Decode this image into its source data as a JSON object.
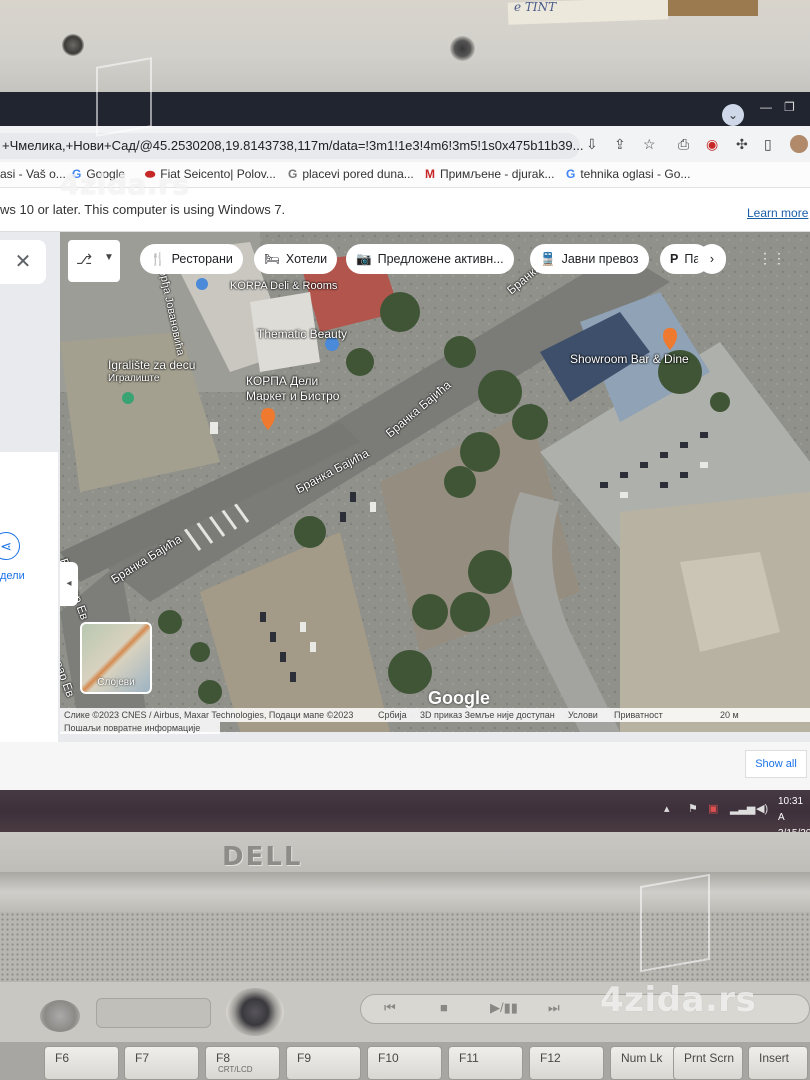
{
  "browser": {
    "url": "+Чмелика,+Нови+Сад/@45.2530208,19.8143738,117m/data=!3m1!1e3!4m6!3m5!1s0x475b11b39...",
    "bookmarks": [
      {
        "icon": "",
        "label": "asi - Vaš o..."
      },
      {
        "icon": "",
        "label": "Fiat Seicento| Polov..."
      },
      {
        "icon": "G",
        "label": "placevi pored duna..."
      },
      {
        "icon": "M",
        "label": "Примљене - djurak..."
      },
      {
        "icon": "G",
        "label": "tehnika oglasi - Go..."
      }
    ],
    "bookmark_google": {
      "icon": "G",
      "label": "Google"
    },
    "infobar": {
      "message": "ws 10 or later. This computer is using Windows 7.",
      "learn_more": "Learn more"
    }
  },
  "maps": {
    "chips": [
      {
        "icon": "🍴",
        "label": "Ресторани"
      },
      {
        "icon": "🛏",
        "label": "Хотели"
      },
      {
        "icon": "📷",
        "label": "Предложене активн..."
      },
      {
        "icon": "🚆",
        "label": "Јавни превоз"
      },
      {
        "icon": "P",
        "label": "Па"
      }
    ],
    "labels": {
      "deli_rooms": "KORPA Deli & Rooms",
      "thematic_beauty": "Thematic Beauty",
      "igraliste": "Igralište za decu",
      "igraliste_cyr": "Игралиште",
      "korpa": "КОРПА Дели",
      "korpa2": "Маркет и Бистро",
      "showroom": "Showroom Bar & Dine",
      "street1": "Бранка Бајића",
      "street2": "Бранка Бајића",
      "street3": "Бранка Бајића",
      "street4": "Бранка Бајића",
      "boulevard": "Булевар Ев",
      "boulevard2": "вар Ев",
      "street_top": "Бранка",
      "street_left": "Ђорђа Јовановића"
    },
    "layers_label": "Слојеви",
    "share_label": "дели",
    "google": "Google",
    "attribution": {
      "imagery": "Слике ©2023 CNES / Airbus, Maxar Technologies, Подаци мапе ©2023",
      "country": "Србија",
      "three_d": "3D приказ Земље није доступан",
      "terms": "Услови",
      "privacy": "Приватност",
      "scale": "20 м"
    },
    "feedback": "Пошаљи повратне информације"
  },
  "page": {
    "show_all": "Show all"
  },
  "taskbar": {
    "time": "10:31 A",
    "date": "3/15/20"
  },
  "hardware": {
    "brand": "DELL",
    "keys": [
      {
        "label": "F6",
        "sub": ""
      },
      {
        "label": "F7",
        "sub": ""
      },
      {
        "label": "F8",
        "sub": "CRT/LCD"
      },
      {
        "label": "F9",
        "sub": ""
      },
      {
        "label": "F10",
        "sub": ""
      },
      {
        "label": "F11",
        "sub": ""
      },
      {
        "label": "F12",
        "sub": ""
      },
      {
        "label": "Num Lk",
        "sub": ""
      },
      {
        "label": "Prnt Scrn",
        "sub": ""
      },
      {
        "label": "Insert",
        "sub": ""
      }
    ]
  },
  "watermark": "4zida.rs",
  "paper_note": "e TINT"
}
